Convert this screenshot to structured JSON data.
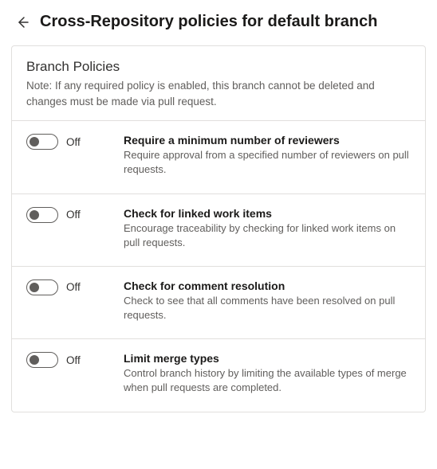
{
  "header": {
    "title": "Cross-Repository policies for default branch"
  },
  "card": {
    "title": "Branch Policies",
    "note": "Note: If any required policy is enabled, this branch cannot be deleted and changes must be made via pull request."
  },
  "toggle": {
    "off_label": "Off"
  },
  "policies": [
    {
      "title": "Require a minimum number of reviewers",
      "desc": "Require approval from a specified number of reviewers on pull requests."
    },
    {
      "title": "Check for linked work items",
      "desc": "Encourage traceability by checking for linked work items on pull requests."
    },
    {
      "title": "Check for comment resolution",
      "desc": "Check to see that all comments have been resolved on pull requests."
    },
    {
      "title": "Limit merge types",
      "desc": "Control branch history by limiting the available types of merge when pull requests are completed."
    }
  ]
}
